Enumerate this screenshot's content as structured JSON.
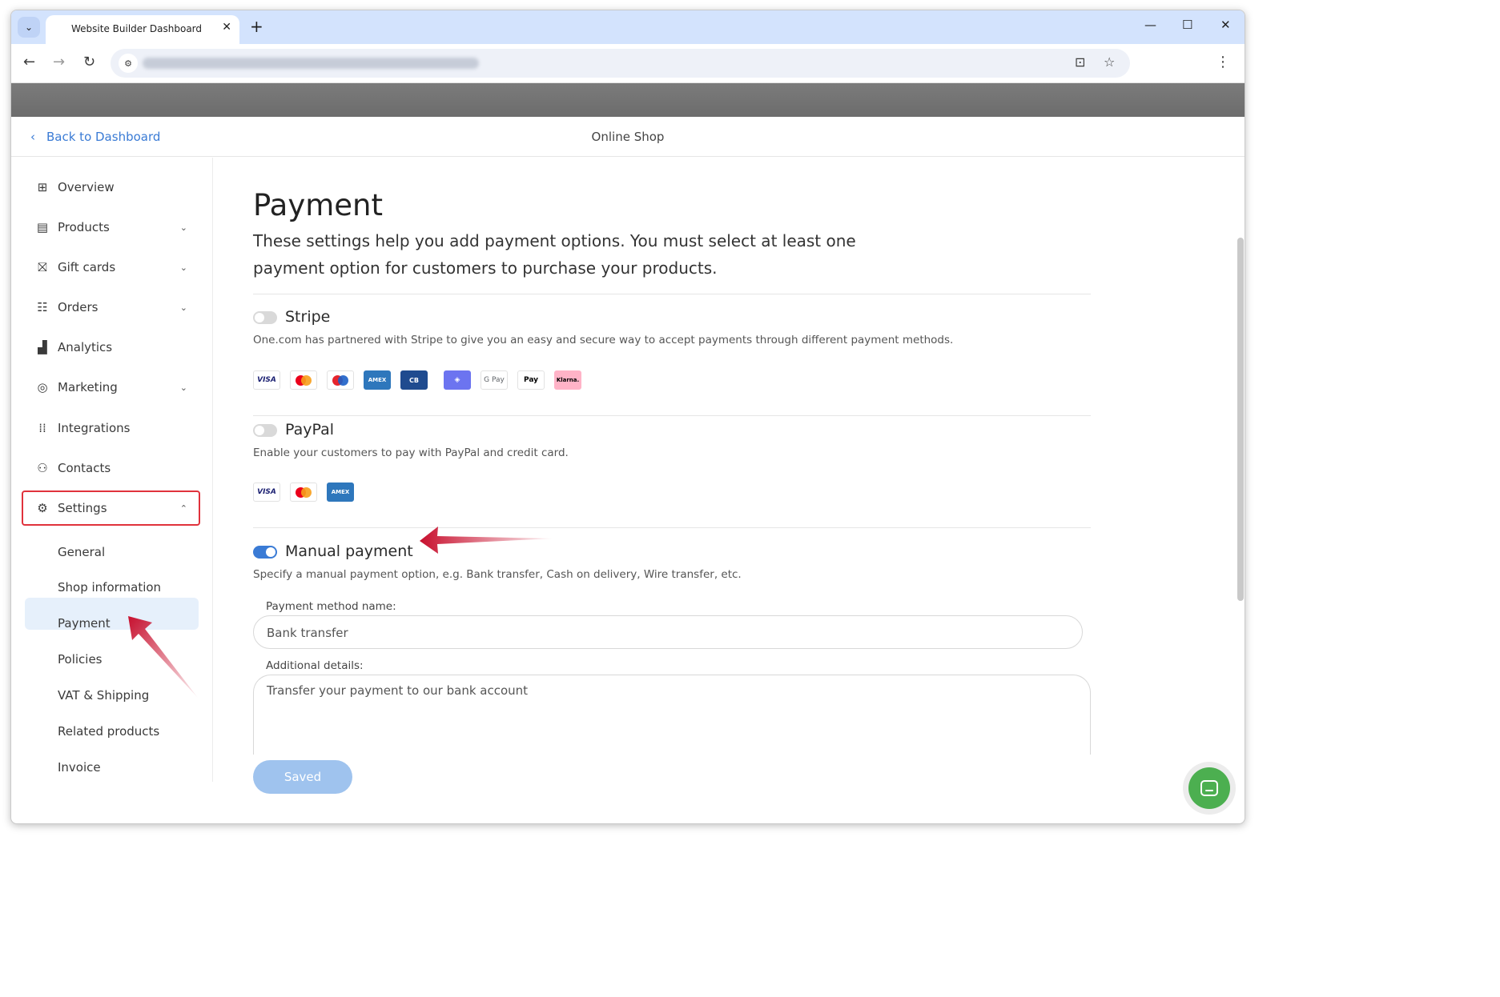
{
  "browser": {
    "tab_title": "Website Builder Dashboard",
    "tab_close_icon": "✕",
    "new_tab_icon": "+",
    "tab_menu_icon": "⌄",
    "minimize_icon": "—",
    "maximize_icon": "☐",
    "close_icon": "✕"
  },
  "header": {
    "back_label": "Back to Dashboard",
    "title": "Online Shop"
  },
  "sidebar": {
    "items": [
      {
        "label": "Overview",
        "icon": "grid-icon",
        "expandable": false
      },
      {
        "label": "Products",
        "icon": "box-icon",
        "expandable": true
      },
      {
        "label": "Gift cards",
        "icon": "gift-icon",
        "expandable": true
      },
      {
        "label": "Orders",
        "icon": "list-icon",
        "expandable": true
      },
      {
        "label": "Analytics",
        "icon": "bar-chart-icon",
        "expandable": false
      },
      {
        "label": "Marketing",
        "icon": "target-icon",
        "expandable": true
      },
      {
        "label": "Integrations",
        "icon": "dots-grid-icon",
        "expandable": false
      },
      {
        "label": "Contacts",
        "icon": "people-icon",
        "expandable": false
      },
      {
        "label": "Settings",
        "icon": "gear-icon",
        "expandable": true,
        "expanded": true
      }
    ],
    "settings_sub": [
      "General",
      "Shop information",
      "Payment",
      "Policies",
      "VAT & Shipping",
      "Related products",
      "Invoice"
    ],
    "active_sub": "Payment"
  },
  "main": {
    "title": "Payment",
    "description": "These settings help you add payment options. You must select at least one payment option for customers to purchase your products.",
    "stripe": {
      "title": "Stripe",
      "enabled": false,
      "description": "One.com has partnered with Stripe to give you an easy and secure way to accept payments through different payment methods.",
      "cards": [
        "VISA",
        "Mastercard",
        "Maestro",
        "AMEX",
        "CB",
        "Link",
        "G Pay",
        "Pay",
        "Klarna."
      ]
    },
    "paypal": {
      "title": "PayPal",
      "enabled": false,
      "description": "Enable your customers to pay with PayPal and credit card.",
      "cards": [
        "VISA",
        "Mastercard",
        "AMEX"
      ]
    },
    "manual": {
      "title": "Manual payment",
      "enabled": true,
      "description": "Specify a manual payment option, e.g. Bank transfer, Cash on delivery, Wire transfer, etc.",
      "method_label": "Payment method name:",
      "method_value": "Bank transfer",
      "details_label": "Additional details:",
      "details_value": "Transfer your payment to our bank account"
    },
    "save_label": "Saved"
  },
  "colors": {
    "accent": "#3a7bd5",
    "highlight_box": "#e0323c",
    "arrow": "#c8102e",
    "chat": "#4caf50"
  }
}
